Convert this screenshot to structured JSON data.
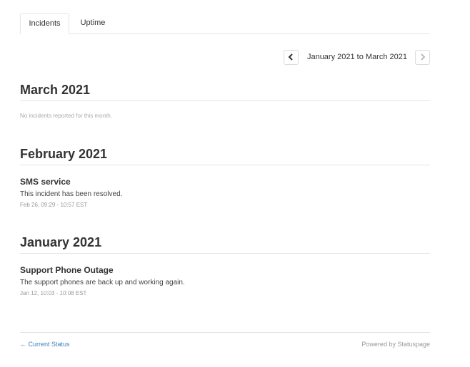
{
  "tabs": [
    {
      "label": "Incidents",
      "active": true
    },
    {
      "label": "Uptime",
      "active": false
    }
  ],
  "pager": {
    "range_label": "January 2021 to March 2021",
    "prev_icon": "chevron-left-icon",
    "next_icon": "chevron-right-icon"
  },
  "months": [
    {
      "title": "March 2021",
      "empty_text": "No incidents reported for this month."
    },
    {
      "title": "February 2021",
      "incidents": [
        {
          "title": "SMS service",
          "message": "This incident has been resolved.",
          "time": "Feb 26, 09:29 - 10:57 EST"
        }
      ]
    },
    {
      "title": "January 2021",
      "incidents": [
        {
          "title": "Support Phone Outage",
          "message": "The support phones are back up and working again.",
          "time": "Jan 12, 10:03 - 10:08 EST"
        }
      ]
    }
  ],
  "footer": {
    "current_status_label": "← Current Status",
    "powered_by": "Powered by Statuspage"
  },
  "colors": {
    "link": "#3d7fc1",
    "border": "#e4e4e4",
    "muted": "#999999"
  }
}
